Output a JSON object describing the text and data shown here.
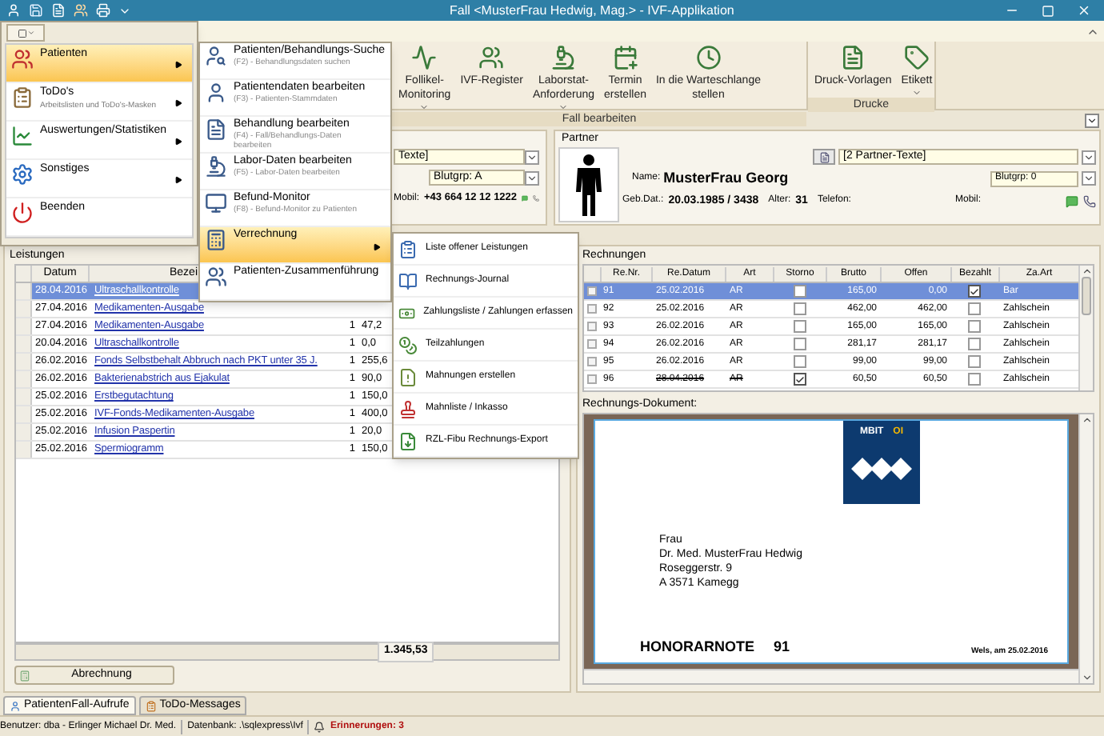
{
  "window": {
    "title": "Fall <MusterFrau Hedwig, Mag.> - IVF-Applikation"
  },
  "ribbon": {
    "groups": [
      {
        "label": "Fall bearbeiten",
        "buttons": [
          {
            "lines": [
              "Follikel-",
              "Monitoring"
            ],
            "dropdown": true
          },
          {
            "lines": [
              "IVF-Register"
            ],
            "dropdown": false
          },
          {
            "lines": [
              "Laborstat-",
              "Anforderung"
            ],
            "dropdown": true
          },
          {
            "lines": [
              "Termin",
              "erstellen"
            ],
            "dropdown": false
          },
          {
            "lines": [
              "In die Warteschlange",
              "stellen"
            ],
            "dropdown": false
          }
        ]
      },
      {
        "label": "Drucke",
        "buttons": [
          {
            "lines": [
              "Druck-Vorlagen"
            ],
            "dropdown": false
          },
          {
            "lines": [
              "Etikett"
            ],
            "dropdown": true
          }
        ]
      }
    ]
  },
  "app_menu": {
    "items": [
      {
        "label": "Patienten",
        "selected": true,
        "has_submenu": true
      },
      {
        "label": "ToDo's",
        "subtitle": "Arbeitslisten und ToDo's-Masken",
        "selected": false,
        "has_submenu": true
      },
      {
        "label": "Auswertungen/Statistiken",
        "selected": false,
        "has_submenu": true
      },
      {
        "label": "Sonstiges",
        "selected": false,
        "has_submenu": true
      },
      {
        "label": "Beenden",
        "selected": false,
        "has_submenu": false
      }
    ]
  },
  "submenu": {
    "items": [
      {
        "label": "Patienten/Behandlungs-Suche",
        "subtitle": "(F2) - Behandlungsdaten suchen",
        "selected": false,
        "has_submenu": false
      },
      {
        "label": "Patientendaten bearbeiten",
        "subtitle": "(F3) - Patienten-Stammdaten",
        "selected": false,
        "has_submenu": false
      },
      {
        "label": "Behandlung bearbeiten",
        "subtitle": "(F4) - Fall/Behandlungs-Daten bearbeiten",
        "selected": false,
        "has_submenu": false
      },
      {
        "label": "Labor-Daten bearbeiten",
        "subtitle": "(F5) - Labor-Daten bearbeiten",
        "selected": false,
        "has_submenu": false
      },
      {
        "label": "Befund-Monitor",
        "subtitle": "(F8) - Befund-Monitor zu Patienten",
        "selected": false,
        "has_submenu": false
      },
      {
        "label": "Verrechnung",
        "selected": true,
        "has_submenu": true
      },
      {
        "label": "Patienten-Zusammenführung",
        "selected": false,
        "has_submenu": false
      }
    ]
  },
  "sub_submenu": {
    "items": [
      {
        "label": "Liste offener Leistungen"
      },
      {
        "label": "Rechnungs-Journal"
      },
      {
        "label": "Zahlungsliste / Zahlungen erfassen"
      },
      {
        "label": "Teilzahlungen"
      },
      {
        "label": "Mahnungen erstellen"
      },
      {
        "label": "Mahnliste / Inkasso"
      },
      {
        "label": "RZL-Fibu Rechnungs-Export"
      }
    ]
  },
  "patient": {
    "notes_combo": "Texte]",
    "blood_group": "Blutgrp: A",
    "mobile_label": "Mobil:",
    "mobile": "+43 664 12 12 1222"
  },
  "partner": {
    "title": "Partner",
    "notes_combo": "[2 Partner-Texte]",
    "name_label": "Name:",
    "name": "MusterFrau Georg",
    "blood_group": "Blutgrp: 0",
    "dob_label": "Geb.Dat.:",
    "dob": "20.03.1985 / 3438",
    "age_label": "Alter:",
    "age": "31",
    "phone_label": "Telefon:",
    "mobile_label": "Mobil:"
  },
  "services": {
    "title": "Leistungen",
    "columns": [
      "Datum",
      "Bezei"
    ],
    "rows": [
      {
        "date": "28.04.2016",
        "name": "Ultraschallkontrolle",
        "qty": "",
        "price": "",
        "selected": true
      },
      {
        "date": "27.04.2016",
        "name": "Medikamenten-Ausgabe",
        "qty": "",
        "price": "",
        "selected": false
      },
      {
        "date": "27.04.2016",
        "name": "Medikamenten-Ausgabe",
        "qty": "1",
        "price": "47,2",
        "selected": false
      },
      {
        "date": "20.04.2016",
        "name": "Ultraschallkontrolle",
        "qty": "1",
        "price": "0,0",
        "selected": false
      },
      {
        "date": "26.02.2016",
        "name": "Fonds Selbstbehalt Abbruch nach PKT unter 35 J.",
        "qty": "1",
        "price": "255,6",
        "selected": false
      },
      {
        "date": "26.02.2016",
        "name": "Bakterienabstrich aus Ejakulat",
        "qty": "1",
        "price": "90,0",
        "selected": false
      },
      {
        "date": "25.02.2016",
        "name": "Erstbegutachtung",
        "qty": "1",
        "price": "150,0",
        "selected": false
      },
      {
        "date": "25.02.2016",
        "name": "IVF-Fonds-Medikamenten-Ausgabe",
        "qty": "1",
        "price": "400,0",
        "selected": false
      },
      {
        "date": "25.02.2016",
        "name": "Infusion Paspertin",
        "qty": "1",
        "price": "20,0",
        "selected": false
      },
      {
        "date": "25.02.2016",
        "name": "Spermiogramm",
        "qty": "1",
        "price": "150,0",
        "selected": false
      }
    ],
    "total": "1.345,53",
    "button": "Abrechnung"
  },
  "invoices": {
    "title": "Rechnungen",
    "columns": [
      "Re.Nr.",
      "Re.Datum",
      "Art",
      "Storno",
      "Brutto",
      "Offen",
      "Bezahlt",
      "Za.Art"
    ],
    "rows": [
      {
        "nr": "91",
        "date": "25.02.2016",
        "type": "AR",
        "storno": false,
        "gross": "165,00",
        "open": "0,00",
        "paid": true,
        "payment": "Bar",
        "selected": true
      },
      {
        "nr": "92",
        "date": "25.02.2016",
        "type": "AR",
        "storno": false,
        "gross": "462,00",
        "open": "462,00",
        "paid": false,
        "payment": "Zahlschein",
        "selected": false
      },
      {
        "nr": "93",
        "date": "26.02.2016",
        "type": "AR",
        "storno": false,
        "gross": "165,00",
        "open": "165,00",
        "paid": false,
        "payment": "Zahlschein",
        "selected": false
      },
      {
        "nr": "94",
        "date": "26.02.2016",
        "type": "AR",
        "storno": false,
        "gross": "281,17",
        "open": "281,17",
        "paid": false,
        "payment": "Zahlschein",
        "selected": false
      },
      {
        "nr": "95",
        "date": "26.02.2016",
        "type": "AR",
        "storno": false,
        "gross": "99,00",
        "open": "99,00",
        "paid": false,
        "payment": "Zahlschein",
        "selected": false
      },
      {
        "nr": "96",
        "date": "28.04.2016",
        "type": "AR",
        "storno": true,
        "gross": "60,50",
        "open": "60,50",
        "paid": false,
        "payment": "Zahlschein",
        "selected": false
      }
    ]
  },
  "document": {
    "title": "Rechnungs-Dokument:",
    "logo": "MBIT",
    "logo_suffix": "OI",
    "address": [
      "Frau",
      "Dr. Med. MusterFrau Hedwig",
      "Roseggerstr. 9",
      "A 3571 Kamegg"
    ],
    "heading": "HONORARNOTE",
    "number": "91",
    "place_date": "Wels, am 25.02.2016"
  },
  "bottom_tabs": [
    {
      "label": "PatientenFall-Aufrufe",
      "selected": true
    },
    {
      "label": "ToDo-Messages",
      "selected": false
    }
  ],
  "status_bar": {
    "user": "Benutzer: dba - Erlinger Michael Dr. Med.",
    "database": "Datenbank: .\\sqlexpress\\Ivf",
    "reminders": "Erinnerungen: 3"
  }
}
